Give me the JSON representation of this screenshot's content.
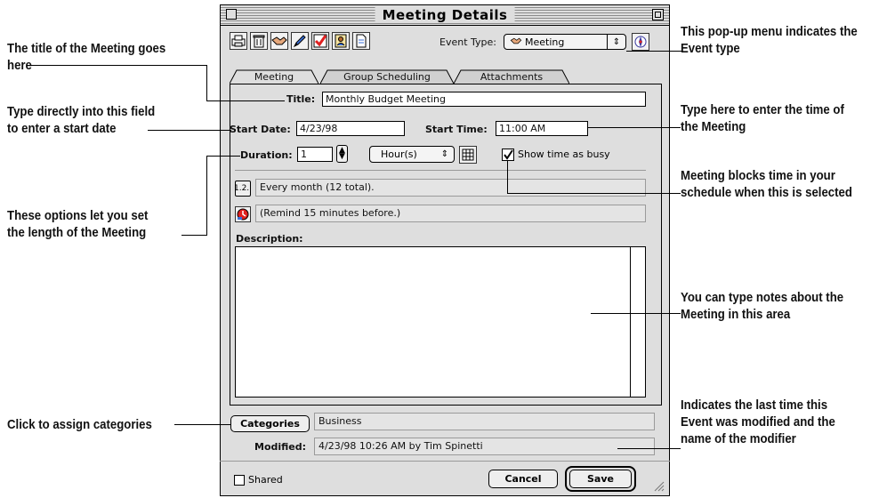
{
  "window": {
    "title": "Meeting Details"
  },
  "toolbar": {
    "icons": [
      "print-icon",
      "trash-icon",
      "handshake-icon",
      "pen-icon",
      "checkmark-icon",
      "contact-card-icon",
      "document-icon"
    ],
    "event_type_label": "Event Type:",
    "event_type_value": "Meeting"
  },
  "tabs": [
    {
      "label": "Meeting",
      "active": true
    },
    {
      "label": "Group Scheduling",
      "active": false
    },
    {
      "label": "Attachments",
      "active": false
    }
  ],
  "form": {
    "title_label": "Title:",
    "title_value": "Monthly Budget Meeting",
    "start_date_label": "Start Date:",
    "start_date_value": "4/23/98",
    "start_time_label": "Start Time:",
    "start_time_value": "11:00 AM",
    "duration_label": "Duration:",
    "duration_value": "1",
    "duration_unit": "Hour(s)",
    "busy_checked": true,
    "busy_label": "Show time as busy",
    "recurrence_button": "1.2..",
    "recurrence_text": "Every month (12 total).",
    "reminder_text": "(Remind 15 minutes before.)",
    "description_label": "Description:",
    "categories_button": "Categories",
    "categories_value": "Business",
    "modified_label": "Modified:",
    "modified_value": "4/23/98 10:26 AM by Tim Spinetti",
    "shared_label": "Shared",
    "cancel_label": "Cancel",
    "save_label": "Save"
  },
  "callouts": {
    "title_field": [
      "The title of the Meeting goes",
      "here"
    ],
    "start_date": [
      "Type directly into this field",
      "to enter a start date"
    ],
    "duration": [
      "These options let you set",
      "the length of the Meeting"
    ],
    "categories": [
      "Click to assign categories"
    ],
    "event_type": [
      "This pop-up menu indicates the",
      "Event type"
    ],
    "start_time": [
      "Type here to enter the time of",
      "the Meeting"
    ],
    "busy": [
      "Meeting blocks time in your",
      "schedule when this is selected"
    ],
    "notes": [
      "You can type notes about the",
      "Meeting in this area"
    ],
    "modified": [
      "Indicates the last time this",
      "Event was modified and the",
      "name of the modifier"
    ]
  }
}
